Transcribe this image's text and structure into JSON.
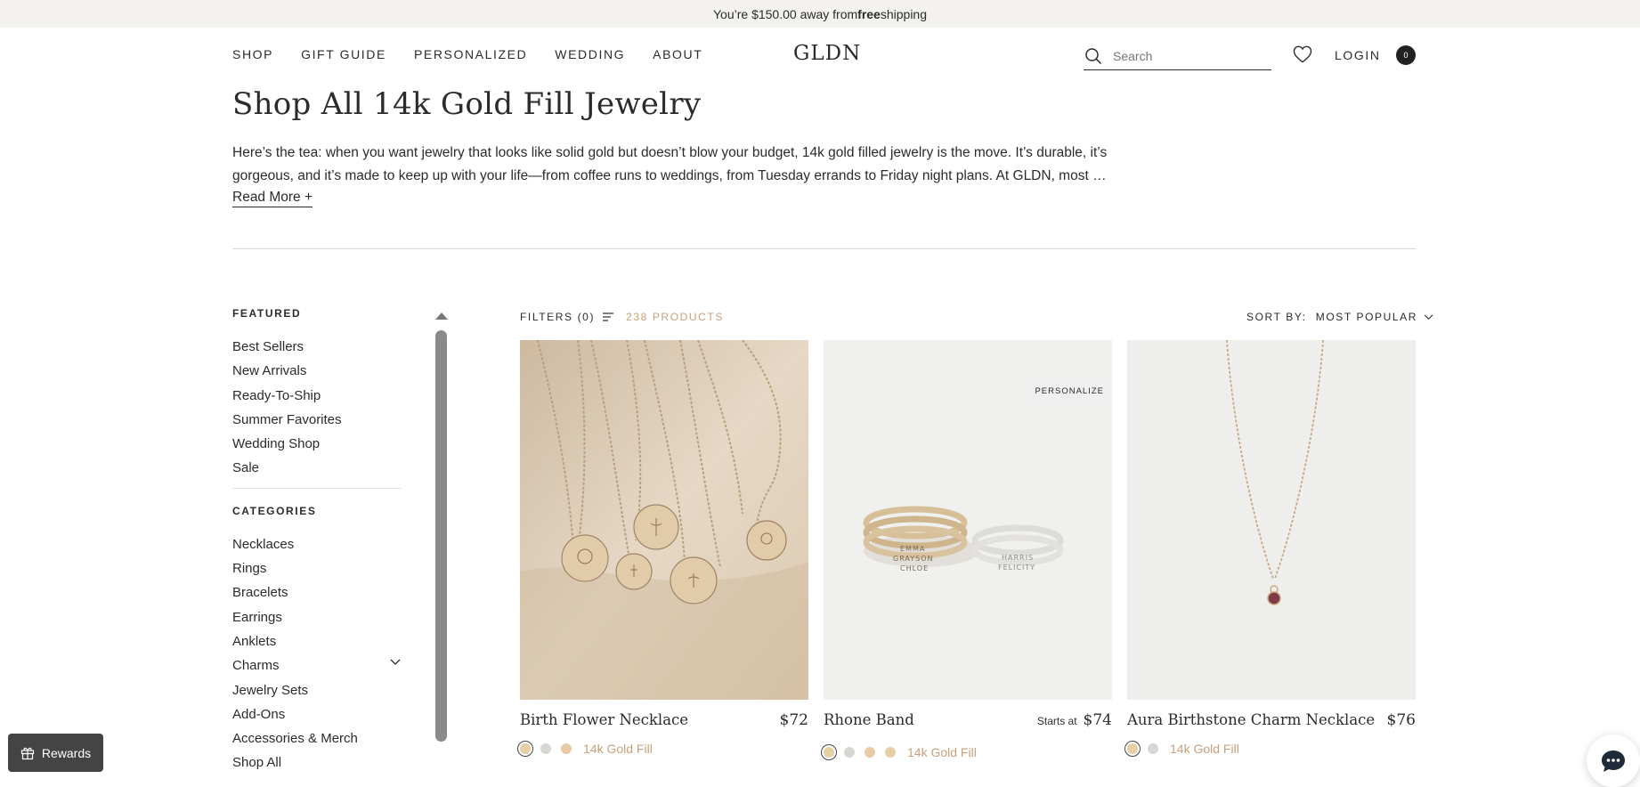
{
  "announcement": {
    "text": "You’re $150.00 away from ",
    "bold": "free",
    "tail": " shipping"
  },
  "header": {
    "nav": [
      "SHOP",
      "GIFT GUIDE",
      "PERSONALIZED",
      "WEDDING",
      "ABOUT"
    ],
    "logo": "GLDN",
    "search_placeholder": "Search",
    "login": "LOGIN",
    "cart_count": "0"
  },
  "page": {
    "title": "Shop All 14k Gold Fill Jewelry",
    "intro_line1": "Here’s the tea: when you want jewelry that looks like solid gold but doesn’t blow your budget, 14k gold filled jewelry is the move. It’s durable, it’s",
    "intro_line2": "gorgeous, and it’s made to keep up with your life—from coffee runs to weddings, from Tuesday errands to Friday night plans. At GLDN, most of ou…",
    "read_more": "Read More +"
  },
  "sidebar": {
    "featured_heading": "FEATURED",
    "featured": [
      "Best Sellers",
      "New Arrivals",
      "Ready-To-Ship",
      "Summer Favorites",
      "Wedding Shop",
      "Sale"
    ],
    "categories_heading": "CATEGORIES",
    "categories": [
      "Necklaces",
      "Rings",
      "Bracelets",
      "Earrings",
      "Anklets",
      "Charms",
      "Jewelry Sets",
      "Add-Ons",
      "Accessories & Merch",
      "Shop All"
    ]
  },
  "toolbar": {
    "filters": "FILTERS (0)",
    "product_count": "238 PRODUCTS",
    "sort_label": "SORT BY:",
    "sort_value": "MOST POPULAR"
  },
  "products": [
    {
      "name": "Birth Flower Necklace",
      "price_prefix": "",
      "price": "$72",
      "swatch_label": "14k Gold Fill",
      "badge": ""
    },
    {
      "name": "Rhone Band",
      "price_prefix": "Starts at",
      "price": "$74",
      "swatch_label": "14k Gold Fill",
      "badge": "PERSONALIZE"
    },
    {
      "name": "Aura Birthstone Charm Necklace",
      "price_prefix": "",
      "price": "$76",
      "swatch_label": "14k Gold Fill",
      "badge": ""
    }
  ],
  "ring_engravings": {
    "left": [
      "EMMA",
      "GRAYSON",
      "CHLOE"
    ],
    "right": [
      "HARRIS",
      "FELICITY"
    ]
  },
  "floating": {
    "rewards": "Rewards"
  },
  "colors": {
    "accent": "#c8a07c",
    "gold_swatch": "#e6cfa4",
    "silver_swatch": "#d8d6d2",
    "rose_swatch": "#e9c9a8",
    "dark": "#2b2b2b"
  }
}
